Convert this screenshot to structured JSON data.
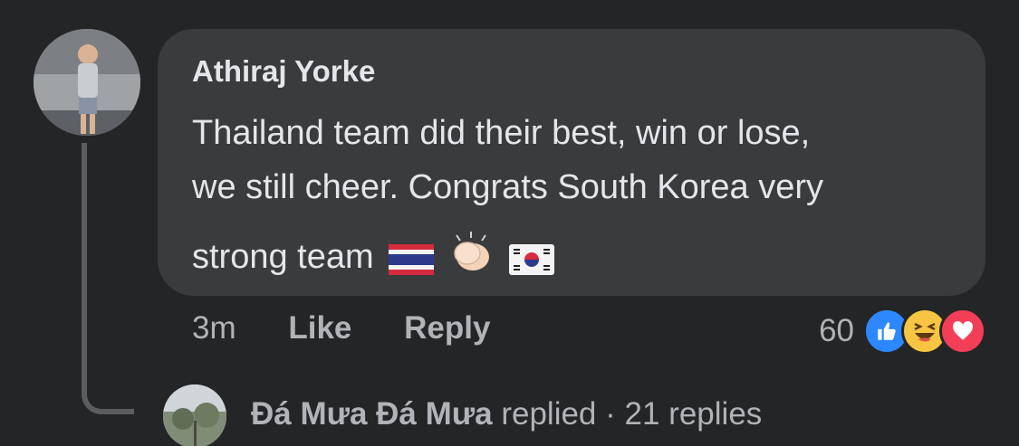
{
  "comment": {
    "author": "Athiraj Yorke",
    "text_line1": "Thailand team did their best, win or lose,",
    "text_line2": "we still cheer. Congrats South Korea very",
    "text_line3": "strong team",
    "emojis": [
      "thailand-flag",
      "clapping-hands",
      "south-korea-flag"
    ]
  },
  "actions": {
    "time": "3m",
    "like_label": "Like",
    "reply_label": "Reply"
  },
  "reactions": {
    "count": "60",
    "types": [
      "like",
      "haha",
      "love"
    ]
  },
  "reply_summary": {
    "replier_name": "Đá Mưa Đá Mưa",
    "replied_label": "replied",
    "separator": "·",
    "replies_count": "21 replies"
  },
  "colors": {
    "background": "#242526",
    "bubble": "#3a3b3c",
    "primary_text": "#e4e6eb",
    "secondary_text": "#b0b3b8",
    "like_blue": "#2d88ff",
    "haha_yellow": "#f7c542",
    "love_red": "#f33e58"
  }
}
